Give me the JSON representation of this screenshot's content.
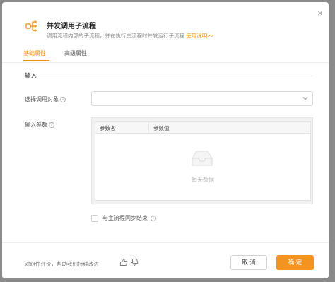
{
  "dialog": {
    "title": "并发调用子流程",
    "subtitle": "调用流程内部的子流程，并在执行主流程时并发运行子流程",
    "subtitle_link": "使用说明>>",
    "close_glyph": "×"
  },
  "tabs": [
    {
      "label": "基础属性",
      "active": true
    },
    {
      "label": "高级属性",
      "active": false
    }
  ],
  "section": {
    "title": "输入"
  },
  "fields": {
    "target_label": "选择调用对象",
    "target_value": "",
    "params_label": "输入参数"
  },
  "table": {
    "columns": [
      "参数名",
      "参数值"
    ],
    "empty_text": "暂无数据"
  },
  "checkbox": {
    "label": "与主流程同步结束",
    "checked": false
  },
  "footer": {
    "feedback": "对组件评价，帮助我们持续改进~",
    "cancel_label": "取 消",
    "ok_label": "确 定"
  },
  "colors": {
    "accent": "#f39320",
    "link": "#f0900f"
  },
  "icons": {
    "header": "flow-branch-icon",
    "close": "close-icon",
    "chevron": "chevron-down-icon",
    "empty": "empty-inbox-icon",
    "info": "info-circle-icon",
    "like": "thumbs-up-icon",
    "dislike": "thumbs-down-icon"
  }
}
